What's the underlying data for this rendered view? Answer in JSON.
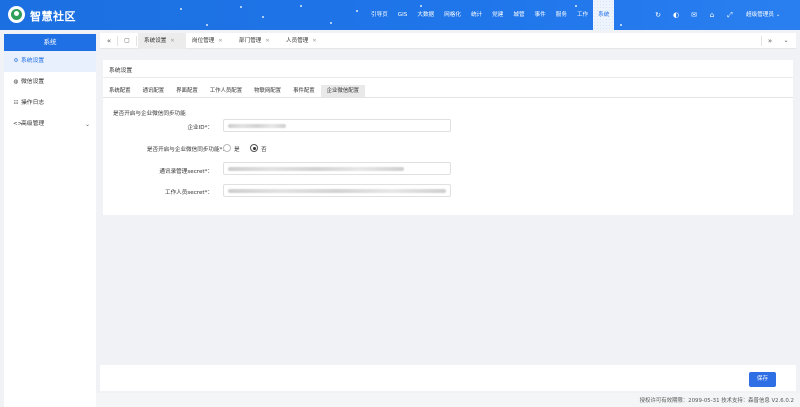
{
  "header": {
    "app_title": "智慧社区",
    "nav": [
      "引导页",
      "GIS",
      "大数据",
      "网格化",
      "统计",
      "党建",
      "城管",
      "事件",
      "服务",
      "工作",
      "系统"
    ],
    "user": "超级管理员"
  },
  "sidebar": {
    "title": "系统",
    "items": [
      {
        "label": "系统设置",
        "icon": "gear-icon"
      },
      {
        "label": "微信设置",
        "icon": "wechat-icon"
      },
      {
        "label": "操作日志",
        "icon": "log-icon"
      },
      {
        "label": "高级管理",
        "icon": "code-icon"
      }
    ]
  },
  "tabbar": {
    "tabs": [
      "系统设置",
      "岗位管理",
      "部门管理",
      "人员管理"
    ]
  },
  "card": {
    "title": "系统设置",
    "sub_tabs": [
      "系统配置",
      "通讯配置",
      "界面配置",
      "工作人员配置",
      "物联网配置",
      "事件配置",
      "企业微信配置"
    ],
    "section_label": "是否开启与企业微信同步功能",
    "fields": {
      "corp_id_label": "企业ID*：",
      "sync_label": "是否开启与企业微信同步功能*：",
      "sync_yes": "是",
      "sync_no": "否",
      "contacts_secret_label": "通讯录管理secret*：",
      "staff_secret_label": "工作人员secret*："
    }
  },
  "actions": {
    "save_label": "保存"
  },
  "footer": {
    "text": "授权许可有效期限：2099-05-31 技术支持：森普信息  V2.6.0.2"
  },
  "colors": {
    "primary": "#1f6fe5",
    "header": "#1f76ea"
  }
}
